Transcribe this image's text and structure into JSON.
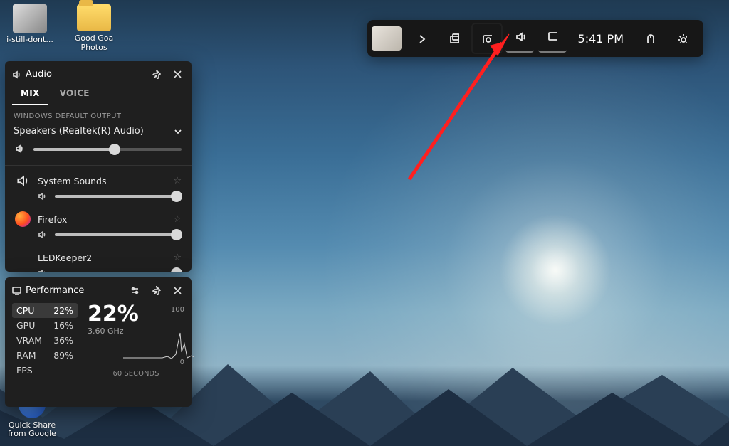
{
  "desktop": {
    "icons": {
      "img_file": "i-still-dont...",
      "folder": "Good Goa Photos",
      "quick_share": "Quick Share from Google"
    }
  },
  "gamebar": {
    "time": "5:41 PM"
  },
  "audio": {
    "title": "Audio",
    "tabs": {
      "mix": "MIX",
      "voice": "VOICE"
    },
    "section_label": "WINDOWS DEFAULT OUTPUT",
    "output_device": "Speakers (Realtek(R) Audio)",
    "master_volume": 55,
    "apps": [
      {
        "name": "System Sounds",
        "volume": 96,
        "icon": "system"
      },
      {
        "name": "Firefox",
        "volume": 96,
        "icon": "firefox"
      },
      {
        "name": "LEDKeeper2",
        "volume": 96,
        "icon": "generic"
      }
    ]
  },
  "performance": {
    "title": "Performance",
    "metrics": [
      {
        "label": "CPU",
        "value": "22%"
      },
      {
        "label": "GPU",
        "value": "16%"
      },
      {
        "label": "VRAM",
        "value": "36%"
      },
      {
        "label": "RAM",
        "value": "89%"
      },
      {
        "label": "FPS",
        "value": "--"
      }
    ],
    "selected_index": 0,
    "big_value": "22%",
    "subtext": "3.60 GHz",
    "y_max": "100",
    "y_min": "0",
    "x_label": "60 SECONDS"
  }
}
